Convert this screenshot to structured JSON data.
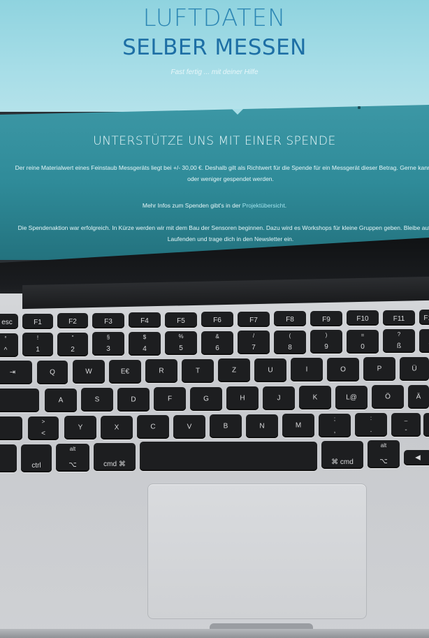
{
  "screen": {
    "hero": {
      "title_line1": "LUFTDATEN",
      "title_line2": "SELBER MESSEN",
      "subtitle": "Fast fertig ... mit deiner Hilfe"
    },
    "band": {
      "heading": "UNTERSTÜTZE UNS MIT EINER SPENDE",
      "paragraph1": "Der reine Materialwert eines Feinstaub Messgeräts liegt bei +/- 30,00 €. Deshalb gilt als Richtwert für die Spende für ein Messgerät dieser Betrag. Gerne kann mehr oder weniger gespendet werden.",
      "paragraph2_prefix": "Mehr Infos zum Spenden gibt's in der ",
      "paragraph2_link": "Projektübersicht",
      "paragraph2_suffix": ".",
      "paragraph3": "Die Spendenaktion war erfolgreich. In Kürze werden wir mit dem Bau der Sensoren beginnen. Dazu wird es Workshops für kleine Gruppen geben. Bleibe auf dem Laufenden und trage dich in den Newsletter ein."
    }
  },
  "keyboard": {
    "row1": [
      {
        "top": "",
        "bot": "esc"
      },
      {
        "top": "",
        "bot": "F1"
      },
      {
        "top": "",
        "bot": "F2"
      },
      {
        "top": "",
        "bot": "F3"
      },
      {
        "top": "",
        "bot": "F4"
      },
      {
        "top": "",
        "bot": "F5"
      },
      {
        "top": "",
        "bot": "F6"
      },
      {
        "top": "",
        "bot": "F7"
      },
      {
        "top": "",
        "bot": "F8"
      },
      {
        "top": "",
        "bot": "F9"
      },
      {
        "top": "",
        "bot": "F10"
      },
      {
        "top": "",
        "bot": "F11"
      },
      {
        "top": "",
        "bot": "F12"
      }
    ],
    "row2": [
      {
        "top": "°",
        "bot": "^"
      },
      {
        "top": "!",
        "bot": "1"
      },
      {
        "top": "\"",
        "bot": "2"
      },
      {
        "top": "§",
        "bot": "3"
      },
      {
        "top": "$",
        "bot": "4"
      },
      {
        "top": "%",
        "bot": "5"
      },
      {
        "top": "&",
        "bot": "6"
      },
      {
        "top": "/",
        "bot": "7"
      },
      {
        "top": "(",
        "bot": "8"
      },
      {
        "top": ")",
        "bot": "9"
      },
      {
        "top": "=",
        "bot": "0"
      },
      {
        "top": "?",
        "bot": "ß"
      },
      {
        "top": "`",
        "bot": "´"
      }
    ],
    "row3": [
      {
        "top": "",
        "bot": "⇥"
      },
      {
        "top": "",
        "bot": "Q"
      },
      {
        "top": "",
        "bot": "W"
      },
      {
        "top": "",
        "bot": "E€"
      },
      {
        "top": "",
        "bot": "R"
      },
      {
        "top": "",
        "bot": "T"
      },
      {
        "top": "",
        "bot": "Z"
      },
      {
        "top": "",
        "bot": "U"
      },
      {
        "top": "",
        "bot": "I"
      },
      {
        "top": "",
        "bot": "O"
      },
      {
        "top": "",
        "bot": "P"
      },
      {
        "top": "",
        "bot": "Ü"
      },
      {
        "top": "",
        "bot": "*"
      }
    ],
    "row4": [
      {
        "top": "",
        "bot": ""
      },
      {
        "top": "",
        "bot": "A"
      },
      {
        "top": "",
        "bot": "S"
      },
      {
        "top": "",
        "bot": "D"
      },
      {
        "top": "",
        "bot": "F"
      },
      {
        "top": "",
        "bot": "G"
      },
      {
        "top": "",
        "bot": "H"
      },
      {
        "top": "",
        "bot": "J"
      },
      {
        "top": "",
        "bot": "K"
      },
      {
        "top": "",
        "bot": "L@"
      },
      {
        "top": "",
        "bot": "Ö"
      },
      {
        "top": "",
        "bot": "Ä"
      }
    ],
    "row5": [
      {
        "top": "",
        "bot": ""
      },
      {
        "top": ">",
        "bot": "<"
      },
      {
        "top": "",
        "bot": "Y"
      },
      {
        "top": "",
        "bot": "X"
      },
      {
        "top": "",
        "bot": "C"
      },
      {
        "top": "",
        "bot": "V"
      },
      {
        "top": "",
        "bot": "B"
      },
      {
        "top": "",
        "bot": "N"
      },
      {
        "top": "",
        "bot": "M"
      },
      {
        "top": ";",
        "bot": ","
      },
      {
        "top": ":",
        "bot": "."
      },
      {
        "top": "_",
        "bot": "-"
      },
      {
        "top": "",
        "bot": ""
      }
    ],
    "row6": [
      {
        "top": "",
        "bot": ""
      },
      {
        "top": "",
        "bot": "ctrl"
      },
      {
        "top": "alt",
        "bot": "⌥"
      },
      {
        "top": "",
        "bot": "cmd ⌘"
      },
      {
        "top": "",
        "bot": ""
      },
      {
        "top": "",
        "bot": "⌘ cmd"
      },
      {
        "top": "alt",
        "bot": "⌥"
      },
      {
        "top": "",
        "bot": "◀"
      }
    ]
  }
}
